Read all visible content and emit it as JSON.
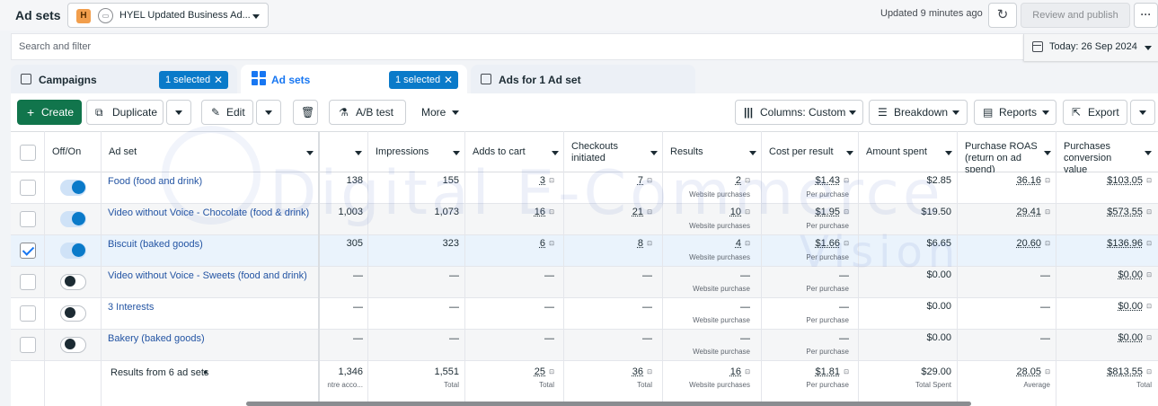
{
  "app": {
    "title": "Ad sets"
  },
  "account": {
    "badge": "H",
    "name": "HYEL Updated Business Ad..."
  },
  "header": {
    "updated": "Updated 9 minutes ago",
    "review_label": "Review and publish",
    "more_label": "···"
  },
  "search": {
    "placeholder": "Search and filter"
  },
  "date": {
    "label": "Today: 26 Sep 2024"
  },
  "tabs": [
    {
      "label": "Campaigns",
      "badge": "1 selected"
    },
    {
      "label": "Ad sets",
      "badge": "1 selected"
    },
    {
      "label": "Ads for 1 Ad set"
    }
  ],
  "toolbar": {
    "create": "Create",
    "duplicate": "Duplicate",
    "edit": "Edit",
    "ab_test": "A/B test",
    "more": "More",
    "columns": "Columns: Custom",
    "breakdown": "Breakdown",
    "reports": "Reports",
    "export": "Export"
  },
  "columns": {
    "off_on": "Off/On",
    "ad_set": "Ad set",
    "impressions": "Impressions",
    "adds_to_cart": "Adds to cart",
    "checkouts": "Checkouts initiated",
    "results": "Results",
    "cost_per_result": "Cost per result",
    "amount_spent": "Amount spent",
    "roas": "Purchase ROAS (return on ad spend)",
    "conversion_value": "Purchases conversion value"
  },
  "rows": [
    {
      "name": "Food (food and drink)",
      "on": true,
      "selected": false,
      "c1": "138",
      "impressions": "155",
      "atc": "3",
      "checkouts": "7",
      "results": "2",
      "results_sub": "Website purchases",
      "cpr": "$1.43",
      "cpr_sub": "Per purchase",
      "spent": "$2.85",
      "roas": "36.16",
      "value": "$103.05"
    },
    {
      "name": "Video without Voice - Chocolate (food & drink)",
      "on": true,
      "selected": false,
      "c1": "1,003",
      "impressions": "1,073",
      "atc": "16",
      "checkouts": "21",
      "results": "10",
      "results_sub": "Website purchases",
      "cpr": "$1.95",
      "cpr_sub": "Per purchase",
      "spent": "$19.50",
      "roas": "29.41",
      "value": "$573.55"
    },
    {
      "name": "Biscuit (baked goods)",
      "on": true,
      "selected": true,
      "c1": "305",
      "impressions": "323",
      "atc": "6",
      "checkouts": "8",
      "results": "4",
      "results_sub": "Website purchases",
      "cpr": "$1.66",
      "cpr_sub": "Per purchase",
      "spent": "$6.65",
      "roas": "20.60",
      "value": "$136.96"
    },
    {
      "name": "Video without Voice - Sweets (food and drink)",
      "on": false,
      "selected": false,
      "c1": "—",
      "impressions": "—",
      "atc": "—",
      "checkouts": "—",
      "results": "—",
      "results_sub": "Website purchase",
      "cpr": "—",
      "cpr_sub": "Per purchase",
      "spent": "$0.00",
      "roas": "—",
      "value": "$0.00"
    },
    {
      "name": "3 Interests",
      "on": false,
      "selected": false,
      "c1": "—",
      "impressions": "—",
      "atc": "—",
      "checkouts": "—",
      "results": "—",
      "results_sub": "Website purchase",
      "cpr": "—",
      "cpr_sub": "Per purchase",
      "spent": "$0.00",
      "roas": "—",
      "value": "$0.00"
    },
    {
      "name": "Bakery (baked goods)",
      "on": false,
      "selected": false,
      "c1": "—",
      "impressions": "—",
      "atc": "—",
      "checkouts": "—",
      "results": "—",
      "results_sub": "Website purchase",
      "cpr": "—",
      "cpr_sub": "Per purchase",
      "spent": "$0.00",
      "roas": "—",
      "value": "$0.00"
    }
  ],
  "totals": {
    "label": "Results from 6 ad sets",
    "c1": "1,346",
    "c1_sub": "ntre acco...",
    "impressions": "1,551",
    "impressions_sub": "Total",
    "atc": "25",
    "atc_sub": "Total",
    "checkouts": "36",
    "checkouts_sub": "Total",
    "results": "16",
    "results_sub": "Website purchases",
    "cpr": "$1.81",
    "cpr_sub": "Per purchase",
    "spent": "$29.00",
    "spent_sub": "Total Spent",
    "roas": "28.05",
    "roas_sub": "Average",
    "value": "$813.55",
    "value_sub": "Total"
  },
  "watermark": {
    "line1": "Digital E-Commerce",
    "line2": "Vision"
  },
  "colors": {
    "accent": "#1877f2",
    "badge": "#0a7ac9",
    "create": "#11754c",
    "link": "#2354a3"
  }
}
